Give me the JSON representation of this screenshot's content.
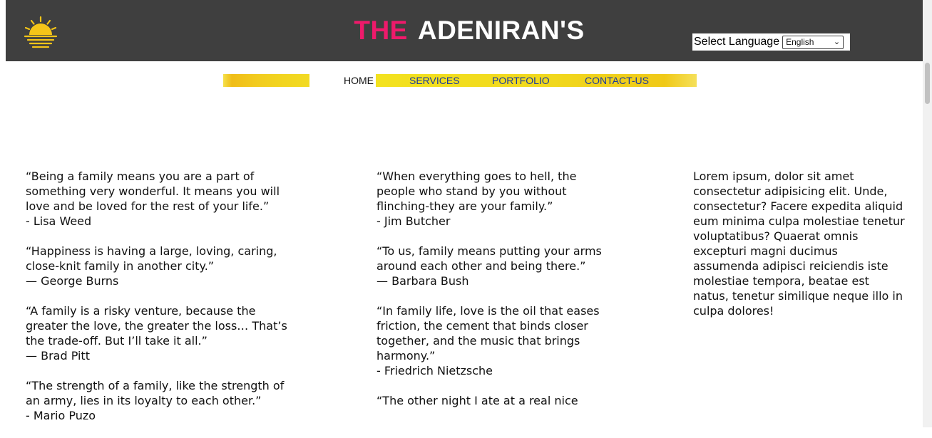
{
  "header": {
    "brand_the": "THE",
    "brand_name": "ADENIRAN'S",
    "logo_icon": "sunset-icon",
    "brand_accent_color": "#ee1a6b",
    "header_bg_color": "#3f3f3f"
  },
  "language": {
    "label": "Select Language",
    "selected": "English"
  },
  "nav": {
    "home": "HOME",
    "services": "SERVICES",
    "portfolio": "PORTFOLIO",
    "contact": "CONTACT-US",
    "bar_color": "#f2d41f"
  },
  "quotes_left": [
    {
      "text": "“Being a family means you are a part of something very wonderful. It means you will love and be loved for the rest of your life.”",
      "author": "- Lisa Weed"
    },
    {
      "text": "“Happiness is having a large, loving, caring, close-knit family in another city.”",
      "author": "— George Burns"
    },
    {
      "text": "“A family is a risky venture, because the greater the love, the greater the loss… That’s the trade-off. But I’ll take it all.”",
      "author": "— Brad Pitt"
    },
    {
      "text": "“The strength of a family, like the strength of an army, lies in its loyalty to each other.”",
      "author": "- Mario Puzo"
    }
  ],
  "quotes_middle": [
    {
      "text": "“When everything goes to hell, the people who stand by you without flinching-they are your family.”",
      "author": "- Jim Butcher"
    },
    {
      "text": "“To us, family means putting your arms around each other and being there.”",
      "author": "— Barbara Bush"
    },
    {
      "text": "“In family life, love is the oil that eases friction, the cement that binds closer together, and the music that brings harmony.”",
      "author": "- Friedrich Nietzsche"
    },
    {
      "text": "“The other night I ate at a real nice",
      "author": ""
    }
  ],
  "right_text": "Lorem ipsum, dolor sit amet consectetur adipisicing elit. Unde, consectetur? Facere expedita aliquid eum minima culpa molestiae tenetur voluptatibus? Quaerat omnis excepturi magni ducimus assumenda adipisci reiciendis iste molestiae tempora, beatae est natus, tenetur similique neque illo in culpa dolores!"
}
